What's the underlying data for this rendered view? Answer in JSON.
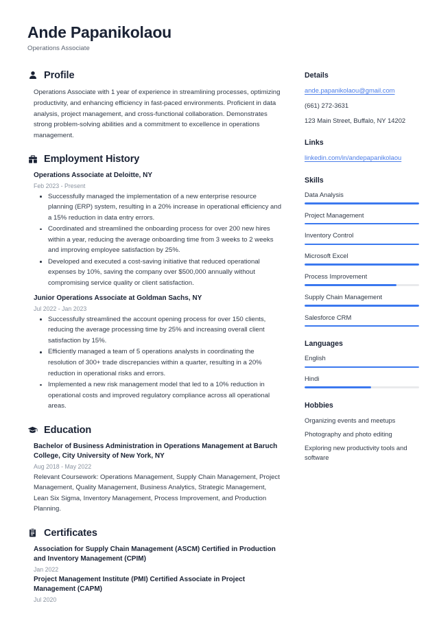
{
  "theme": {
    "accent": "#3b78ef",
    "link": "#4a7ce8",
    "heading": "#1a2234",
    "text": "#2f3846",
    "muted": "#8b94a1",
    "track": "#e9eaec",
    "background": "#ffffff"
  },
  "header": {
    "name": "Ande Papanikolaou",
    "job_title": "Operations Associate"
  },
  "sections": {
    "profile": {
      "icon": "user-icon",
      "title": "Profile",
      "text": "Operations Associate with 1 year of experience in streamlining processes, optimizing productivity, and enhancing efficiency in fast-paced environments. Proficient in data analysis, project management, and cross-functional collaboration. Demonstrates strong problem-solving abilities and a commitment to excellence in operations management."
    },
    "employment": {
      "icon": "briefcase-icon",
      "title": "Employment History",
      "entries": [
        {
          "title": "Operations Associate at Deloitte, NY",
          "date": "Feb 2023 - Present",
          "bullets": [
            "Successfully managed the implementation of a new enterprise resource planning (ERP) system, resulting in a 20% increase in operational efficiency and a 15% reduction in data entry errors.",
            "Coordinated and streamlined the onboarding process for over 200 new hires within a year, reducing the average onboarding time from 3 weeks to 2 weeks and improving employee satisfaction by 25%.",
            "Developed and executed a cost-saving initiative that reduced operational expenses by 10%, saving the company over $500,000 annually without compromising service quality or client satisfaction."
          ]
        },
        {
          "title": "Junior Operations Associate at Goldman Sachs, NY",
          "date": "Jul 2022 - Jan 2023",
          "bullets": [
            "Successfully streamlined the account opening process for over 150 clients, reducing the average processing time by 25% and increasing overall client satisfaction by 15%.",
            "Efficiently managed a team of 5 operations analysts in coordinating the resolution of 300+ trade discrepancies within a quarter, resulting in a 20% reduction in operational risks and errors.",
            "Implemented a new risk management model that led to a 10% reduction in operational costs and improved regulatory compliance across all operational areas."
          ]
        }
      ]
    },
    "education": {
      "icon": "graduation-cap-icon",
      "title": "Education",
      "entries": [
        {
          "title": "Bachelor of Business Administration in Operations Management at Baruch College, City University of New York, NY",
          "date": "Aug 2018 - May 2022",
          "description": "Relevant Coursework: Operations Management, Supply Chain Management, Project Management, Quality Management, Business Analytics, Strategic Management, Lean Six Sigma, Inventory Management, Process Improvement, and Production Planning."
        }
      ]
    },
    "certificates": {
      "icon": "clipboard-icon",
      "title": "Certificates",
      "entries": [
        {
          "title": "Association for Supply Chain Management (ASCM) Certified in Production and Inventory Management (CPIM)",
          "date": "Jan 2022"
        },
        {
          "title": "Project Management Institute (PMI) Certified Associate in Project Management (CAPM)",
          "date": "Jul 2020"
        }
      ]
    }
  },
  "sidebar": {
    "details": {
      "title": "Details",
      "email": "ande.papanikolaou@gmail.com",
      "phone": "(661) 272-3631",
      "address": "123 Main Street, Buffalo, NY 14202"
    },
    "links": {
      "title": "Links",
      "items": [
        {
          "label": "linkedin.com/in/andepapanikolaou"
        }
      ]
    },
    "skills": {
      "title": "Skills",
      "items": [
        {
          "label": "Data Analysis",
          "level": 100
        },
        {
          "label": "Project Management",
          "level": 100
        },
        {
          "label": "Inventory Control",
          "level": 100
        },
        {
          "label": "Microsoft Excel",
          "level": 100
        },
        {
          "label": "Process Improvement",
          "level": 80
        },
        {
          "label": "Supply Chain Management",
          "level": 100
        },
        {
          "label": "Salesforce CRM",
          "level": 100
        }
      ]
    },
    "languages": {
      "title": "Languages",
      "items": [
        {
          "label": "English",
          "level": 100
        },
        {
          "label": "Hindi",
          "level": 58
        }
      ]
    },
    "hobbies": {
      "title": "Hobbies",
      "items": [
        "Organizing events and meetups",
        "Photography and photo editing",
        "Exploring new productivity tools and software"
      ]
    }
  }
}
